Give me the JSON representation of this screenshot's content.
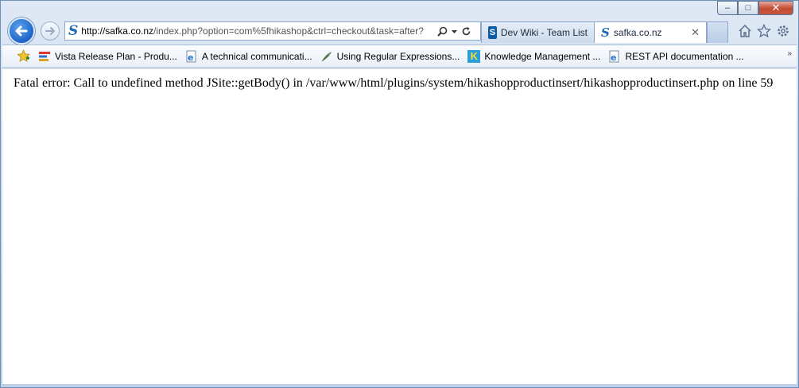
{
  "window": {
    "minimize_glyph": "–",
    "maximize_glyph": "□",
    "close_glyph": "✕"
  },
  "nav": {
    "address_url_host": "http://safka.co.nz",
    "address_url_rest": "/index.php?option=com%5fhikashop&ctrl=checkout&task=after?",
    "site_icon_glyph": "S"
  },
  "tabs": [
    {
      "label": "Dev Wiki - Team List",
      "icon": "sharepoint-icon",
      "icon_glyph": "S",
      "active": false
    },
    {
      "label": "safka.co.nz",
      "icon": "site-s-icon",
      "icon_glyph": "S",
      "active": true,
      "close_glyph": "✕"
    }
  ],
  "favorites": [
    {
      "label": "Vista Release Plan - Produ...",
      "icon": "project-icon"
    },
    {
      "label": "A technical communicati...",
      "icon": "ie-page-icon"
    },
    {
      "label": "Using Regular Expressions...",
      "icon": "feather-icon"
    },
    {
      "label": "Knowledge Management ...",
      "icon": "k-icon",
      "icon_glyph": "K"
    },
    {
      "label": "REST API documentation ...",
      "icon": "ie-page-icon"
    }
  ],
  "favorites_overflow_glyph": "»",
  "page": {
    "error_message": "Fatal error: Call to undefined method JSite::getBody() in /var/www/html/plugins/system/hikashopproductinsert/hikashopproductinsert.php on line 59"
  },
  "colors": {
    "accent": "#1e63c7",
    "close_button": "#c44a31",
    "chrome_background": "#c9daef"
  }
}
